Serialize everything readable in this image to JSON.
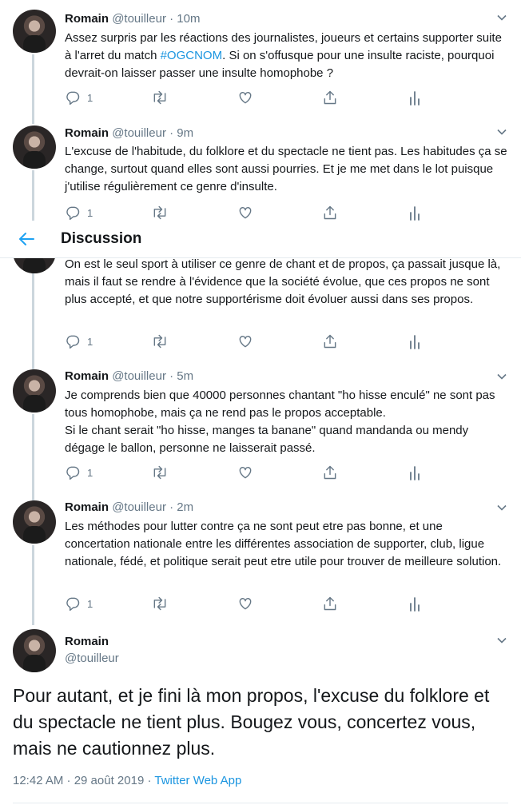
{
  "header": {
    "title": "Discussion",
    "back_icon": "arrow-left-icon",
    "accent": "#1da1f2"
  },
  "tweets": [
    {
      "name": "Romain",
      "handle": "@touilleur",
      "time": "10m",
      "text_before": "Assez surpris par les réactions des journalistes, joueurs et certains supporter suite à l'arret du match ",
      "hashtag": "#OGCNOM",
      "text_after": ". Si on s'offusque pour une insulte raciste, pourquoi devrait-on laisser passer une insulte homophobe ?",
      "replies": "1"
    },
    {
      "name": "Romain",
      "handle": "@touilleur",
      "time": "9m",
      "text": "L'excuse de l'habitude, du folklore et du spectacle ne tient pas. Les habitudes ça se change, surtout quand elles sont aussi pourries. Et je me met dans le lot puisque j'utilise régulièrement ce genre d'insulte.",
      "replies": "1"
    },
    {
      "text": "On est le seul sport à utiliser ce genre de chant et de propos, ça passait jusque là, mais il faut se rendre à l'évidence que la société évolue, que ces propos ne sont plus accepté, et que notre supportérisme doit évoluer aussi dans ses propos.",
      "replies": "1"
    },
    {
      "name": "Romain",
      "handle": "@touilleur",
      "time": "5m",
      "text": "Je comprends bien que 40000 personnes chantant \"ho hisse enculé\" ne sont pas tous homophobe, mais ça ne rend pas le propos acceptable.\nSi le chant serait \"ho hisse, manges ta banane\" quand mandanda ou mendy dégage le ballon, personne ne laisserait passé.",
      "replies": "1"
    },
    {
      "name": "Romain",
      "handle": "@touilleur",
      "time": "2m",
      "text": "Les méthodes pour lutter contre ça ne sont peut etre pas bonne, et une concertation nationale entre les différentes association de supporter, club, ligue nationale, fédé, et politique serait peut etre utile pour trouver de meilleure solution.",
      "replies": "1"
    }
  ],
  "main_tweet": {
    "name": "Romain",
    "handle": "@touilleur",
    "text": "Pour autant, et je fini là mon propos, l'excuse du folklore et du spectacle ne tient plus. Bougez vous, concertez vous, mais ne cautionnez plus.",
    "timestamp": "12:42 AM · 29 août 2019 · ",
    "source": "Twitter Web App"
  },
  "separator": " · ",
  "icons": [
    "reply-icon",
    "retweet-icon",
    "like-icon",
    "share-icon",
    "analytics-icon",
    "chevron-down-icon"
  ]
}
